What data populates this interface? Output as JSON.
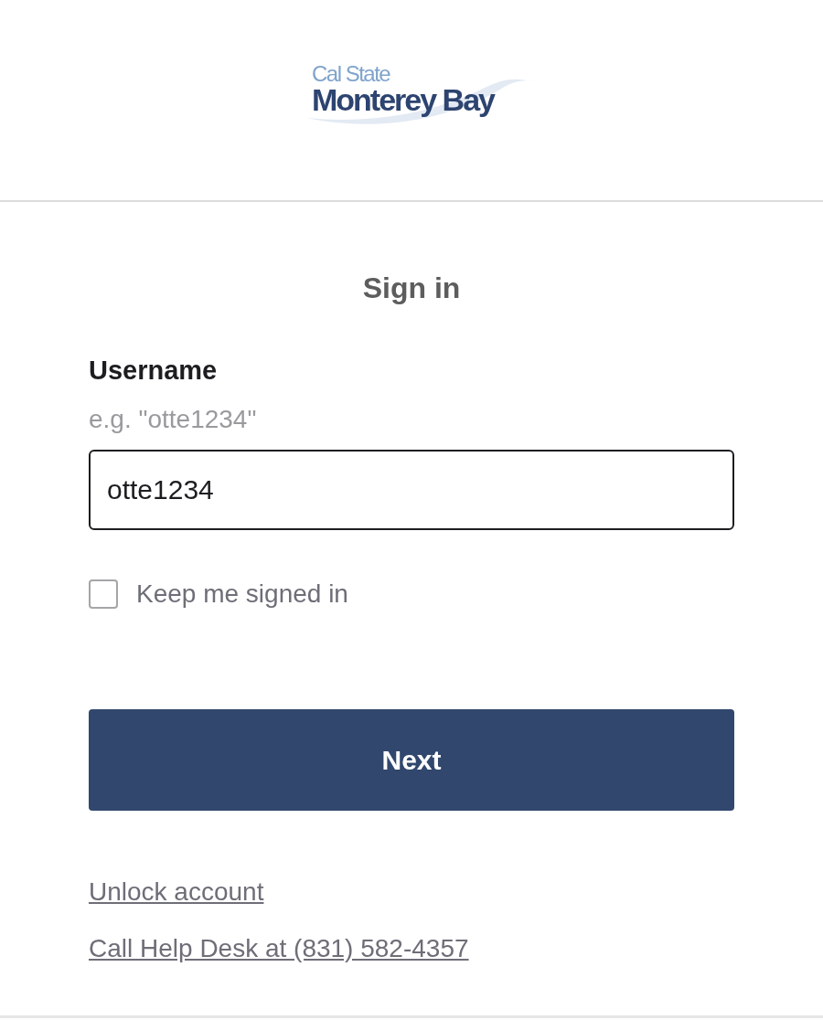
{
  "logo": {
    "line_1": "Cal State",
    "line_2": "Monterey Bay"
  },
  "title": "Sign in",
  "username": {
    "label": "Username",
    "hint": "e.g. \"otte1234\"",
    "value": "otte1234"
  },
  "keep_signed_in": {
    "label": "Keep me signed in",
    "checked": false
  },
  "submit": {
    "label": "Next"
  },
  "links": [
    "Unlock account",
    "Call Help Desk at (831) 582-4357"
  ]
}
